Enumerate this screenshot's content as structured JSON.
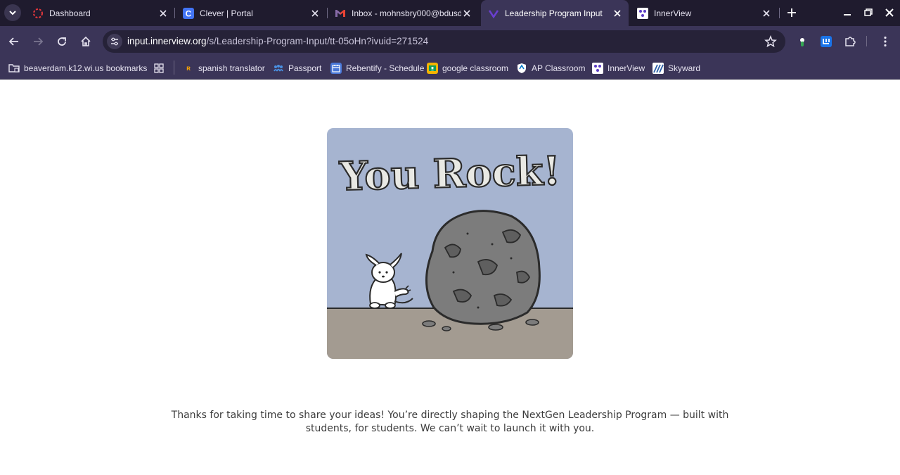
{
  "browser": {
    "tabs": [
      {
        "title": "Dashboard",
        "icon": "dashboard-favicon"
      },
      {
        "title": "Clever | Portal",
        "icon": "clever-favicon"
      },
      {
        "title": "Inbox - mohnsbry000@bdusd",
        "icon": "gmail-favicon"
      },
      {
        "title": "Leadership Program Input",
        "icon": "innerview-favicon",
        "active": true
      },
      {
        "title": "InnerView",
        "icon": "innerview-favicon"
      }
    ],
    "address": {
      "host": "input.innerview.org",
      "path": "/s/Leadership-Program-Input/tt-05oHn?ivuid=271524"
    },
    "bookmarks": {
      "folder": "beaverdam.k12.wi.us bookmarks",
      "items": [
        {
          "label": "spanish translator",
          "icon": "spanishdict-icon"
        },
        {
          "label": "Passport",
          "icon": "passport-icon"
        },
        {
          "label": "Rebentify - Schedule",
          "icon": "rebentify-icon"
        },
        {
          "label": "google classroom",
          "icon": "classroom-icon"
        },
        {
          "label": "AP Classroom",
          "icon": "ap-classroom-icon"
        },
        {
          "label": "InnerView",
          "icon": "innerview-icon"
        },
        {
          "label": "Skyward",
          "icon": "skyward-icon"
        }
      ]
    }
  },
  "page": {
    "illustration_text": "You Rock!",
    "message_line1": "Thanks for taking  time to share your ideas! You’re directly shaping the NextGen Leadership Program — built with",
    "message_line2": "students, for students. We can’t wait to launch it with you."
  },
  "colors": {
    "tabstrip": "#1f1b2e",
    "toolbar": "#3b3558",
    "omnibox": "#262238",
    "sky": "#a6b4d0",
    "ground": "#a39b91",
    "rock": "#7c7c7c",
    "text": "#3c3c3c"
  }
}
